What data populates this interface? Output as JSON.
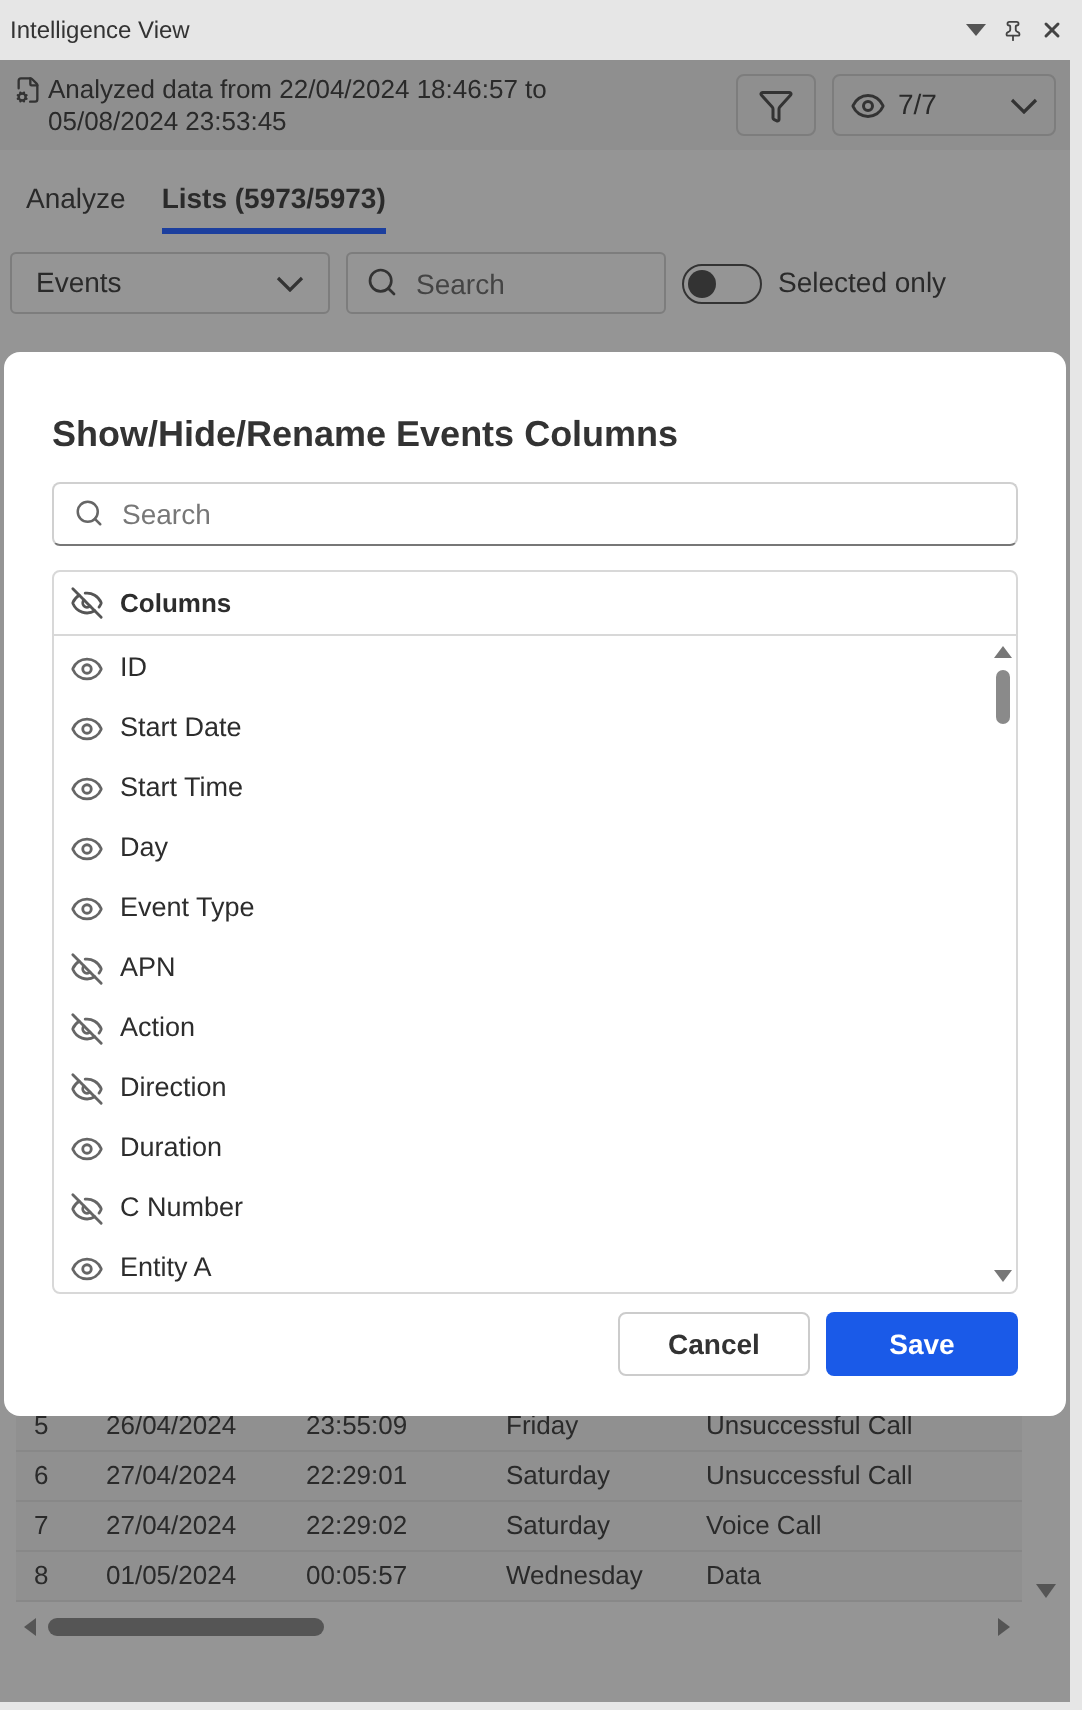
{
  "window": {
    "title": "Intelligence View"
  },
  "header": {
    "line1_prefix": "Analyzed data from",
    "date_from": "22/04/2024 18:46:57",
    "line1_suffix": "to",
    "date_to": "05/08/2024 23:53:45",
    "visibility_count": "7/7"
  },
  "tabs": [
    {
      "label": "Analyze",
      "selected": false
    },
    {
      "label": "Lists (5973/5973)",
      "selected": true
    }
  ],
  "list_select": {
    "value": "Events"
  },
  "search": {
    "placeholder": "Search"
  },
  "selected_only": {
    "label": "Selected only",
    "on": false
  },
  "table": {
    "rows": [
      [
        "5",
        "26/04/2024",
        "23:55:09",
        "Friday",
        "Unsuccessful Call"
      ],
      [
        "6",
        "27/04/2024",
        "22:29:01",
        "Saturday",
        "Unsuccessful Call"
      ],
      [
        "7",
        "27/04/2024",
        "22:29:02",
        "Saturday",
        "Voice Call"
      ],
      [
        "8",
        "01/05/2024",
        "00:05:57",
        "Wednesday",
        "Data"
      ]
    ]
  },
  "dialog": {
    "title": "Show/Hide/Rename Events Columns",
    "search_placeholder": "Search",
    "header": "Columns",
    "columns": [
      {
        "name": "ID",
        "visible": true
      },
      {
        "name": "Start Date",
        "visible": true
      },
      {
        "name": "Start Time",
        "visible": true
      },
      {
        "name": "Day",
        "visible": true
      },
      {
        "name": "Event Type",
        "visible": true
      },
      {
        "name": "APN",
        "visible": false
      },
      {
        "name": "Action",
        "visible": false
      },
      {
        "name": "Direction",
        "visible": false
      },
      {
        "name": "Duration",
        "visible": true
      },
      {
        "name": "C Number",
        "visible": false
      },
      {
        "name": "Entity A",
        "visible": true
      }
    ],
    "buttons": [
      {
        "label": "Cancel",
        "kind": "secondary"
      },
      {
        "label": "Save",
        "kind": "primary"
      }
    ]
  }
}
